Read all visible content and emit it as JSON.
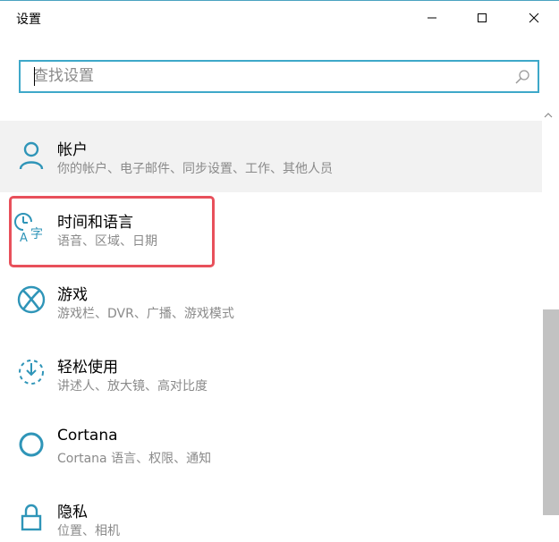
{
  "window": {
    "title": "设置"
  },
  "search": {
    "placeholder": "查找设置",
    "value": ""
  },
  "colors": {
    "accent": "#3ea8c9",
    "highlight": "#e8505b",
    "desc_text": "#8a8a8a"
  },
  "settings_items": [
    {
      "name": "帐户",
      "description": "你的帐户、电子邮件、同步设置、工作、其他人员",
      "icon": "person-icon"
    },
    {
      "name": "时间和语言",
      "description": "语音、区域、日期",
      "icon": "time-language-icon"
    },
    {
      "name": "游戏",
      "description": "游戏栏、DVR、广播、游戏模式",
      "icon": "xbox-icon"
    },
    {
      "name": "轻松使用",
      "description": "讲述人、放大镜、高对比度",
      "icon": "ease-of-access-icon"
    },
    {
      "name": "Cortana",
      "description": "Cortana 语言、权限、通知",
      "icon": "cortana-icon"
    },
    {
      "name": "隐私",
      "description": "位置、相机",
      "icon": "lock-icon"
    }
  ]
}
